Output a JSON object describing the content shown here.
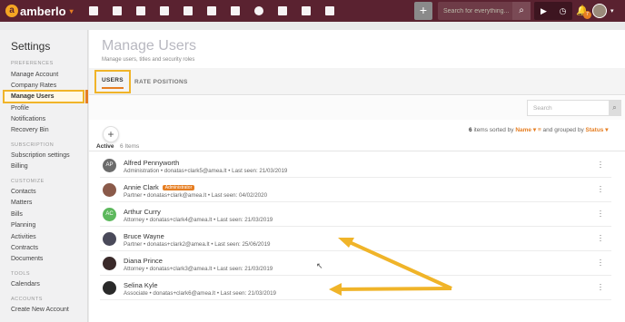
{
  "app": {
    "logo_text": "amberlo",
    "logo_mark": "a"
  },
  "topbar": {
    "add_label": "+",
    "search_placeholder": "Search for everything...",
    "notification_count": "7"
  },
  "sidebar": {
    "title": "Settings",
    "sections": [
      {
        "heading": "PREFERENCES",
        "items": [
          "Manage Account",
          "Company Rates",
          "Manage Users",
          "Profile",
          "Notifications",
          "Recovery Bin"
        ]
      },
      {
        "heading": "SUBSCRIPTION",
        "items": [
          "Subscription settings",
          "Billing"
        ]
      },
      {
        "heading": "CUSTOMIZE",
        "items": [
          "Contacts",
          "Matters",
          "Bills",
          "Planning",
          "Activities",
          "Contracts",
          "Documents"
        ]
      },
      {
        "heading": "TOOLS",
        "items": [
          "Calendars"
        ]
      },
      {
        "heading": "ACCOUNTS",
        "items": [
          "Create New Account"
        ]
      }
    ]
  },
  "main": {
    "title": "Manage Users",
    "subtitle": "Manage users, titles and security roles",
    "tabs": [
      "USERS",
      "RATE POSITIONS"
    ],
    "search_placeholder": "Search",
    "sort": {
      "count": "6",
      "items_text": "items sorted by",
      "sort_field": "Name",
      "grouped_text": "and grouped by",
      "group_field": "Status"
    },
    "active_label": "Active",
    "active_count": "6 Items",
    "users": [
      {
        "initials": "AP",
        "avatar_color": "#6b6b6b",
        "name": "Alfred Pennyworth",
        "badge": "",
        "meta": "Administration  •  donatas+clark5@amea.lt  •  Last seen: 21/03/2019"
      },
      {
        "initials": "",
        "avatar_color": "#8a5a4a",
        "name": "Annie Clark",
        "badge": "Administrator",
        "meta": "Partner  •  donatas+clark@amea.lt  •  Last seen: 04/02/2020"
      },
      {
        "initials": "AC",
        "avatar_color": "#5cb85c",
        "name": "Arthur Curry",
        "badge": "",
        "meta": "Attorney  •  donatas+clark4@amea.lt  •  Last seen: 21/03/2019"
      },
      {
        "initials": "",
        "avatar_color": "#4a4a5a",
        "name": "Bruce Wayne",
        "badge": "",
        "meta": "Partner  •  donatas+clark2@amea.lt  •  Last seen: 25/06/2019"
      },
      {
        "initials": "",
        "avatar_color": "#3a2a2a",
        "name": "Diana Prince",
        "badge": "",
        "meta": "Attorney  •  donatas+clark3@amea.lt  •  Last seen: 21/03/2019"
      },
      {
        "initials": "",
        "avatar_color": "#2a2a2a",
        "name": "Selina Kyle",
        "badge": "",
        "meta": "Associate  •  donatas+clark6@amea.lt  •  Last seen: 21/03/2019"
      }
    ]
  },
  "colors": {
    "topbar": "#5a2230",
    "accent": "#e67e22",
    "highlight": "#f0b429"
  }
}
